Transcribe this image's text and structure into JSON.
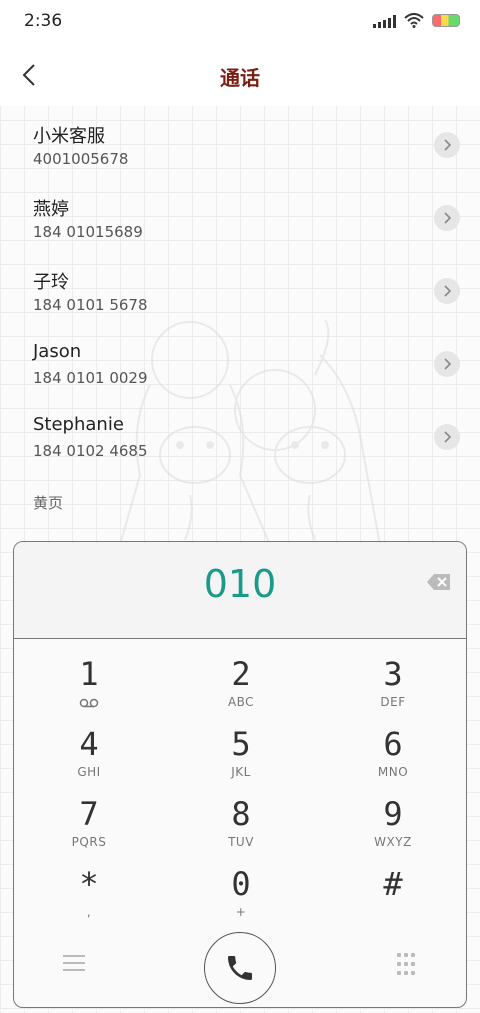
{
  "status_bar": {
    "time": "2:36"
  },
  "header": {
    "title": "通话"
  },
  "contacts": [
    {
      "name": "小米客服",
      "number": "4001005678"
    },
    {
      "name": "燕婷",
      "number": "184 01015689"
    },
    {
      "name": "子玲",
      "number": "184 0101 5678"
    },
    {
      "name": "Jason",
      "number": "184 0101 0029"
    },
    {
      "name": "Stephanie",
      "number": "184 0102 4685"
    }
  ],
  "section_header": "黄页",
  "dialer": {
    "dialed_number": "010",
    "keys": [
      {
        "digit": "1",
        "letters": "ᴑᴑ"
      },
      {
        "digit": "2",
        "letters": "ABC"
      },
      {
        "digit": "3",
        "letters": "DEF"
      },
      {
        "digit": "4",
        "letters": "GHI"
      },
      {
        "digit": "5",
        "letters": "JKL"
      },
      {
        "digit": "6",
        "letters": "MNO"
      },
      {
        "digit": "7",
        "letters": "PQRS"
      },
      {
        "digit": "8",
        "letters": "TUV"
      },
      {
        "digit": "9",
        "letters": "WXYZ"
      },
      {
        "digit": "*",
        "letters": ","
      },
      {
        "digit": "0",
        "letters": "+"
      },
      {
        "digit": "#",
        "letters": ""
      }
    ]
  },
  "colors": {
    "title": "#7b1f14",
    "dialed_number": "#1a9b8a"
  },
  "icons": [
    "back-icon",
    "chevron-right-icon",
    "backspace-icon",
    "voicemail-icon",
    "menu-icon",
    "phone-icon",
    "keypad-icon",
    "wifi-icon",
    "signal-icon",
    "battery-icon"
  ]
}
